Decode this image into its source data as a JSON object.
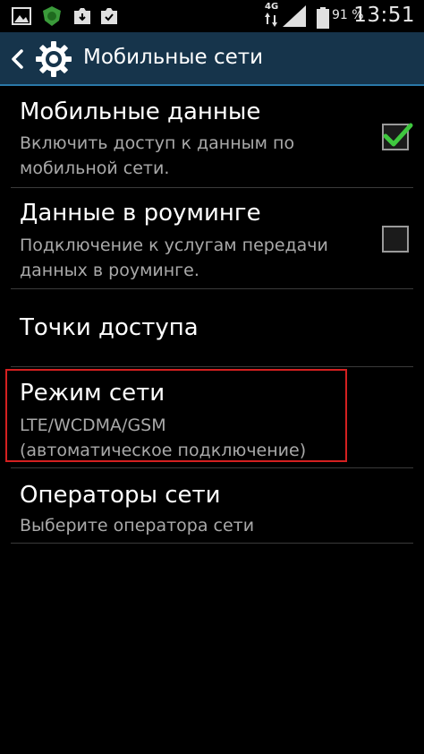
{
  "status_bar": {
    "icons": [
      "image-icon",
      "shield-icon",
      "download-icon",
      "store-icon"
    ],
    "network_type": "4G",
    "battery_percent": "91 %",
    "time": "13:51"
  },
  "action_bar": {
    "title": "Мобильные сети",
    "accent_color": "#2a78a8"
  },
  "settings": {
    "mobile_data": {
      "title": "Мобильные данные",
      "summary_line1": "Включить доступ к данным по",
      "summary_line2": "мобильной сети.",
      "checked": true
    },
    "data_roaming": {
      "title": "Данные в роуминге",
      "summary_line1": "Подключение к услугам передачи",
      "summary_line2": "данных в роуминге.",
      "checked": false
    },
    "access_points": {
      "title": "Точки доступа"
    },
    "network_mode": {
      "title": "Режим сети",
      "summary_line1": "LTE/WCDMA/GSM",
      "summary_line2": "(автоматическое подключение)"
    },
    "network_operators": {
      "title": "Операторы сети",
      "summary_line1": "Выберите оператора сети"
    }
  },
  "colors": {
    "check_green": "#3fc83f",
    "highlight_red": "#d42020"
  }
}
